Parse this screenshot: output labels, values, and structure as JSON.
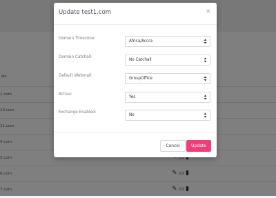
{
  "modal": {
    "title": "Update test1.com",
    "close_symbol": "×",
    "fields": [
      {
        "label": "Domain Timezone:",
        "value": "Africa/Accra"
      },
      {
        "label": "Domain Catchall:",
        "value": "No Catchall"
      },
      {
        "label": "Default Webmail:",
        "value": "GroupOffice"
      },
      {
        "label": "Active:",
        "value": "Yes"
      },
      {
        "label": "Exchange Enabled:",
        "value": "No"
      }
    ],
    "cancel_label": "Cancel",
    "update_label": "Update",
    "accent_color": "#ef3f7a"
  },
  "background": {
    "column_header": "ain",
    "rows": [
      "1.com",
      "10.com",
      "11.com",
      "4.com",
      "5.com",
      "6.com",
      "7.com"
    ],
    "row_actions": [
      "pencil-icon",
      "monitor-icon",
      "trash-icon"
    ]
  }
}
